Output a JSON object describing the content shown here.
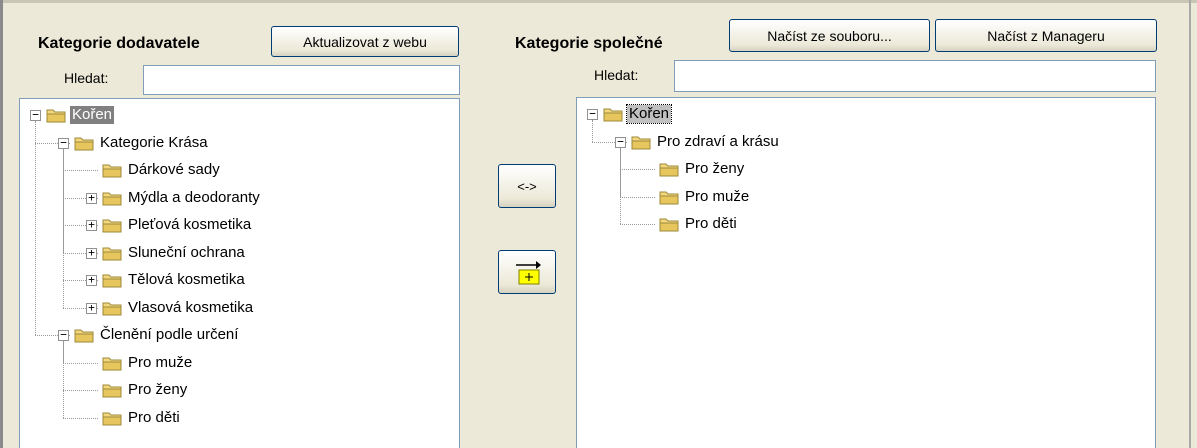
{
  "left": {
    "title": "Kategorie dodavatele",
    "update_button": "Aktualizovat z webu",
    "search_label": "Hledat:",
    "search_value": "",
    "tree": [
      {
        "label": "Kořen",
        "level": 0,
        "expander": "minus",
        "selected": true
      },
      {
        "label": "Kategorie Krása",
        "level": 1,
        "expander": "minus"
      },
      {
        "label": "Dárkové sady",
        "level": 2,
        "expander": "none"
      },
      {
        "label": "Mýdla a deodoranty",
        "level": 2,
        "expander": "plus"
      },
      {
        "label": "Pleťová kosmetika",
        "level": 2,
        "expander": "plus"
      },
      {
        "label": "Sluneční ochrana",
        "level": 2,
        "expander": "plus"
      },
      {
        "label": "Tělová kosmetika",
        "level": 2,
        "expander": "plus"
      },
      {
        "label": "Vlasová kosmetika",
        "level": 2,
        "expander": "plus"
      },
      {
        "label": "Členění podle určení",
        "level": 1,
        "expander": "minus"
      },
      {
        "label": "Pro muže",
        "level": 2,
        "expander": "none"
      },
      {
        "label": "Pro ženy",
        "level": 2,
        "expander": "none"
      },
      {
        "label": "Pro děti",
        "level": 2,
        "expander": "none"
      }
    ]
  },
  "middle": {
    "swap_button": "<->",
    "move_icon": "arrow-into-folder-icon"
  },
  "right": {
    "title": "Kategorie společné",
    "load_file_button": "Načíst ze souboru...",
    "load_manager_button": "Načíst z Manageru",
    "search_label": "Hledat:",
    "search_value": "",
    "tree": [
      {
        "label": "Kořen",
        "level": 0,
        "expander": "minus",
        "focused": true
      },
      {
        "label": "Pro zdraví a krásu",
        "level": 1,
        "expander": "minus"
      },
      {
        "label": "Pro ženy",
        "level": 2,
        "expander": "none"
      },
      {
        "label": "Pro muže",
        "level": 2,
        "expander": "none"
      },
      {
        "label": "Pro děti",
        "level": 2,
        "expander": "none"
      }
    ]
  },
  "colors": {
    "window_bg": "#ece9d8",
    "selection_bg": "#808080",
    "border_blue": "#7f9db9",
    "folder_yellow": "#f3d77e"
  }
}
